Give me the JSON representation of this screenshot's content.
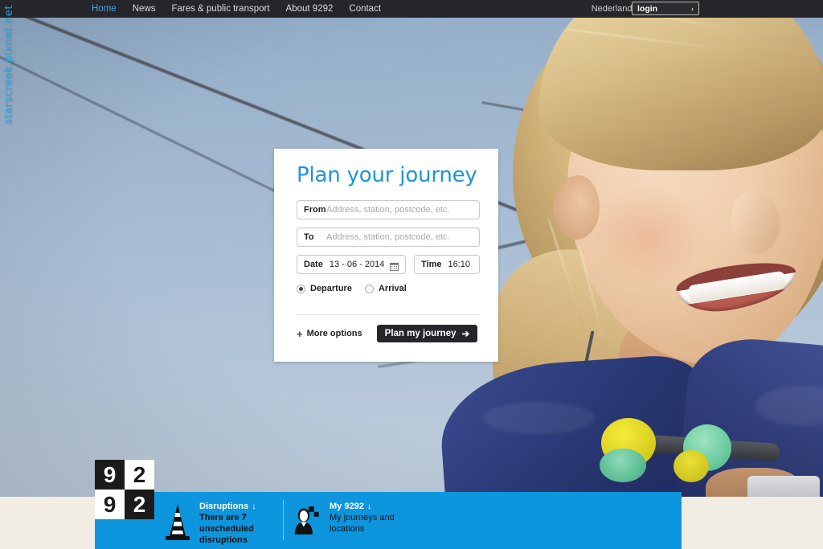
{
  "watermark": "starscreek.pixnet.net",
  "topnav": {
    "links": [
      {
        "label": "Home",
        "active": true
      },
      {
        "label": "News",
        "active": false
      },
      {
        "label": "Fares & public transport",
        "active": false
      },
      {
        "label": "About 9292",
        "active": false
      },
      {
        "label": "Contact",
        "active": false
      }
    ],
    "language": "Nederlands",
    "accessibility_icon": "ear-hearing-icon",
    "contrast_icon": "contrast-half-circle-icon",
    "login_label": "login",
    "login_chevron": "›",
    "background_color": "#26262a",
    "active_color": "#3fa5e8"
  },
  "planner": {
    "title": "Plan your journey",
    "title_color": "#1f95d8",
    "from": {
      "label": "From",
      "value": "",
      "placeholder": "Address, station, postcode, etc."
    },
    "to": {
      "label": "To",
      "value": "",
      "placeholder": "Address, station, postcode, etc."
    },
    "date": {
      "label": "Date",
      "value": "13 - 06 - 2014",
      "icon": "calendar-icon"
    },
    "time": {
      "label": "Time",
      "value": "16:10"
    },
    "radios": [
      {
        "label": "Departure",
        "selected": true
      },
      {
        "label": "Arrival",
        "selected": false
      }
    ],
    "more_options": {
      "plus": "+",
      "label": "More options"
    },
    "submit": {
      "label": "Plan my journey",
      "arrow": "➔"
    }
  },
  "logo": {
    "cells": [
      "9",
      "2",
      "9",
      "2"
    ]
  },
  "bottom_bar": {
    "background_color": "#0d95dd",
    "panels": [
      {
        "icon": "traffic-cone-icon",
        "title": "Disruptions",
        "arrow": "↓",
        "body": "There are 7 unscheduled disruptions"
      },
      {
        "icon": "user-profile-icon",
        "title": "My 9292",
        "arrow": "↓",
        "body": "My journeys and locations"
      }
    ]
  },
  "page_background_color": "#f1ece4"
}
